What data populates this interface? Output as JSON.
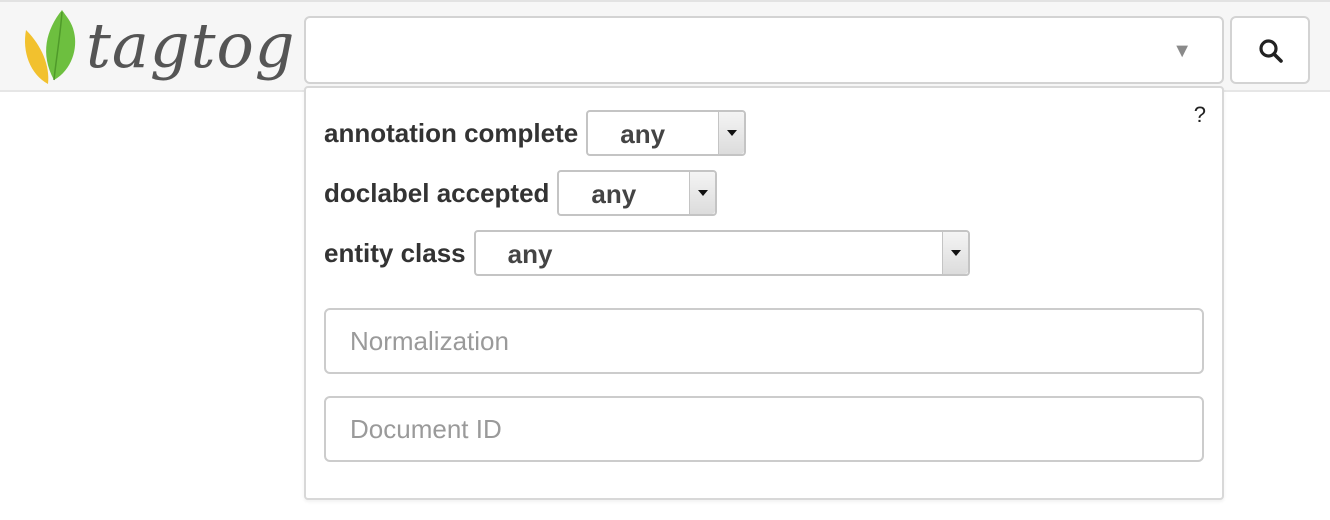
{
  "header": {
    "logo_text": "tagtog",
    "search": {
      "value": "",
      "caret": "▼"
    },
    "search_button_icon": "search-icon"
  },
  "filters": {
    "help_label": "?",
    "rows": [
      {
        "label": "annotation complete",
        "value": "any"
      },
      {
        "label": "doclabel accepted",
        "value": "any"
      },
      {
        "label": "entity class",
        "value": "any"
      }
    ],
    "inputs": {
      "normalization_placeholder": "Normalization",
      "document_id_placeholder": "Document ID"
    }
  },
  "colors": {
    "leaf_green": "#6dbf3f",
    "leaf_yellow": "#f2c12e",
    "logo_text": "#555555"
  }
}
